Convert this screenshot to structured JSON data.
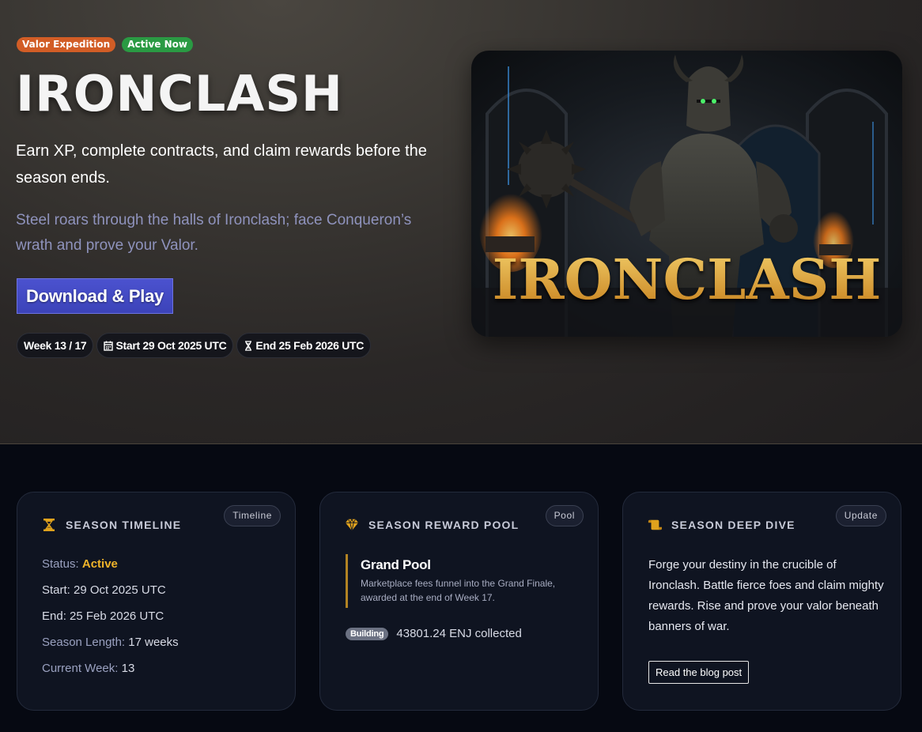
{
  "hero": {
    "badges": [
      "Valor Expedition",
      "Active Now"
    ],
    "title": "IRONCLASH",
    "subtitle": "Earn XP, complete contracts, and claim rewards before the season ends.",
    "lore": "Steel roars through the halls of Ironclash; face Conqueron’s wrath and prove your Valor.",
    "cta_label": "Download & Play",
    "pills": {
      "week": "Week 13 / 17",
      "start": "Start 29 Oct 2025 UTC",
      "end": "End 25 Feb 2026 UTC"
    },
    "key_art_logo": "IRONCLASH"
  },
  "cards": {
    "timeline": {
      "tag": "Timeline",
      "heading": "SEASON TIMELINE",
      "icon": "hourglass-icon",
      "rows": {
        "status_key": "Status:",
        "status_value": "Active",
        "start": "Start: 29 Oct 2025 UTC",
        "end": "End: 25 Feb 2026 UTC",
        "length_key": "Season Length:",
        "length_value": "17 weeks",
        "week_key": "Current Week:",
        "week_value": "13"
      }
    },
    "pool": {
      "tag": "Pool",
      "heading": "SEASON REWARD POOL",
      "icon": "gem-icon",
      "title": "Grand Pool",
      "description": "Marketplace fees funnel into the Grand Finale, awarded at the end of Week 17.",
      "status": "Building",
      "amount": "43801.24 ENJ collected"
    },
    "deep_dive": {
      "tag": "Update",
      "heading": "SEASON DEEP DIVE",
      "icon": "scroll-icon",
      "text": "Forge your destiny in the crucible of Ironclash. Battle fierce foes and claim mighty rewards. Rise and prove your valor beneath banners of war.",
      "button": "Read the blog post"
    }
  },
  "colors": {
    "accent_orange": "#d25d26",
    "accent_green": "#2a9a43",
    "button_blue": "#3c43b9",
    "gold": "#f0b42a"
  }
}
